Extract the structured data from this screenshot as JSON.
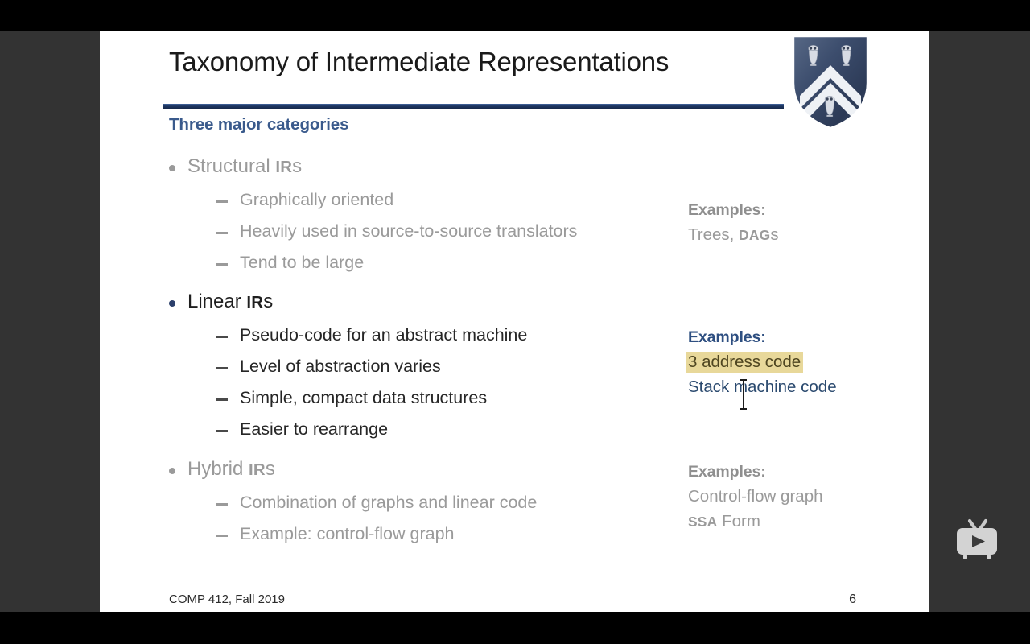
{
  "window": {
    "chrome_color": "#000000",
    "stage_color": "#333333",
    "slide_bg": "#ffffff"
  },
  "slide": {
    "title": "Taxonomy of Intermediate Representations",
    "section_heading": "Three major categories",
    "rule_color": "#1f3864",
    "accent_color": "#3a5a8c",
    "dim_color": "#9a9a9a",
    "highlight_color": "#e8d89a",
    "logo": {
      "name": "rice-university-shield",
      "field_color": "#3e4f6e",
      "chevron_color": "#f2f4f7",
      "owl_count": 3
    },
    "groups": [
      {
        "id": "structural",
        "state": "dim",
        "label_main": "Structural ",
        "label_smallcaps": "IR",
        "label_tail": "s",
        "subs": [
          "Graphically oriented",
          "Heavily used in source-to-source translators",
          "Tend to be large"
        ]
      },
      {
        "id": "linear",
        "state": "active",
        "label_main": "Linear ",
        "label_smallcaps": "IR",
        "label_tail": "s",
        "subs": [
          "Pseudo-code for an abstract machine",
          "Level of abstraction varies",
          "Simple, compact data structures",
          "Easier to rearrange"
        ]
      },
      {
        "id": "hybrid",
        "state": "dim",
        "label_main": "Hybrid ",
        "label_smallcaps": "IR",
        "label_tail": "s",
        "subs": [
          "Combination of graphs and linear code",
          "Example: control-flow graph"
        ]
      }
    ],
    "examples": [
      {
        "id": "examples-structural",
        "state": "dim",
        "heading": "Examples:",
        "lines": [
          {
            "pre": "Trees, ",
            "smallcaps": "DAG",
            "post": "s",
            "highlight": false
          }
        ]
      },
      {
        "id": "examples-linear",
        "state": "active",
        "heading": "Examples:",
        "lines": [
          {
            "pre": "3 address code",
            "smallcaps": "",
            "post": "",
            "highlight": true
          },
          {
            "pre": "Stack machine code",
            "smallcaps": "",
            "post": "",
            "highlight": false
          }
        ]
      },
      {
        "id": "examples-hybrid",
        "state": "dim",
        "heading": "Examples:",
        "lines": [
          {
            "pre": "Control-flow graph",
            "smallcaps": "",
            "post": "",
            "highlight": false
          },
          {
            "pre": "",
            "smallcaps": "SSA",
            "post": " Form",
            "highlight": false
          }
        ]
      }
    ],
    "footer": {
      "left": "COMP 412, Fall 2019",
      "page_number": "6"
    }
  },
  "overlay": {
    "player_icon": "tv-play-icon",
    "cursor_icon": "text-ibeam-cursor"
  }
}
